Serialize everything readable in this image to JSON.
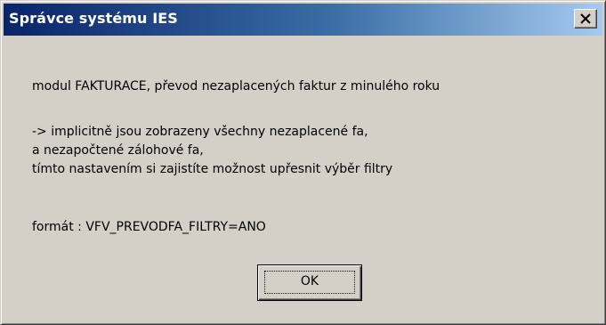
{
  "window": {
    "title": "Správce systému IES",
    "close_icon": "close-x-icon"
  },
  "message": {
    "line1": "modul FAKTURACE, převod nezaplacených faktur z minulého roku",
    "line2": "-> implicitně jsou zobrazeny všechny nezaplacené fa,",
    "line3": "a nezapočtené zálohové fa,",
    "line4": "tímto nastavením si zajistíte možnost upřesnit výběr filtry",
    "line5": "formát : VFV_PREVODFA_FILTRY=ANO"
  },
  "buttons": {
    "ok_label": "OK"
  },
  "colors": {
    "title_bar_start": "#0a246a",
    "title_bar_end": "#a6caf0",
    "dialog_face": "#d4d0c8"
  }
}
